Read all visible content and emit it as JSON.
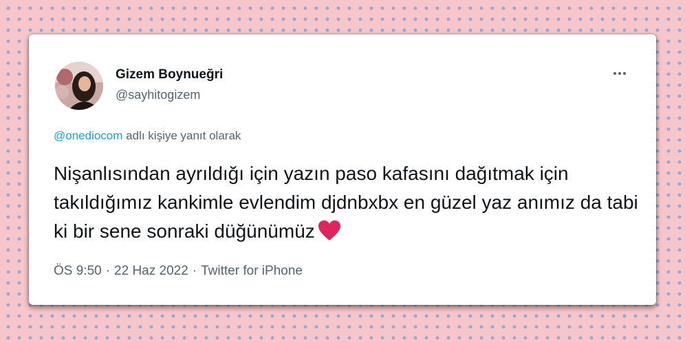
{
  "tweet": {
    "display_name": "Gizem Boynueğri",
    "handle": "@sayhitogizem",
    "reply_to_mention": "@onediocom",
    "reply_to_suffix": " adlı kişiye yanıt olarak",
    "text": "Nişanlısından ayrıldığı için yazın paso kafasını dağıtmak için takıldığımız kankimle evlendim djdnbxbx en güzel yaz anımız da tabi ki bir sene sonraki düğünümüz",
    "emoji_icon": "red-heart-icon",
    "time": "ÖS 9:50",
    "separator": "·",
    "date": "22 Haz 2022",
    "source": "Twitter for iPhone"
  },
  "colors": {
    "background_pink": "#f6c6cb",
    "dot_blue": "#9aa6d6",
    "text_primary": "#0f1419",
    "text_secondary": "#536471",
    "link_blue": "#1d9bf0",
    "heart_red": "#e0245e"
  }
}
